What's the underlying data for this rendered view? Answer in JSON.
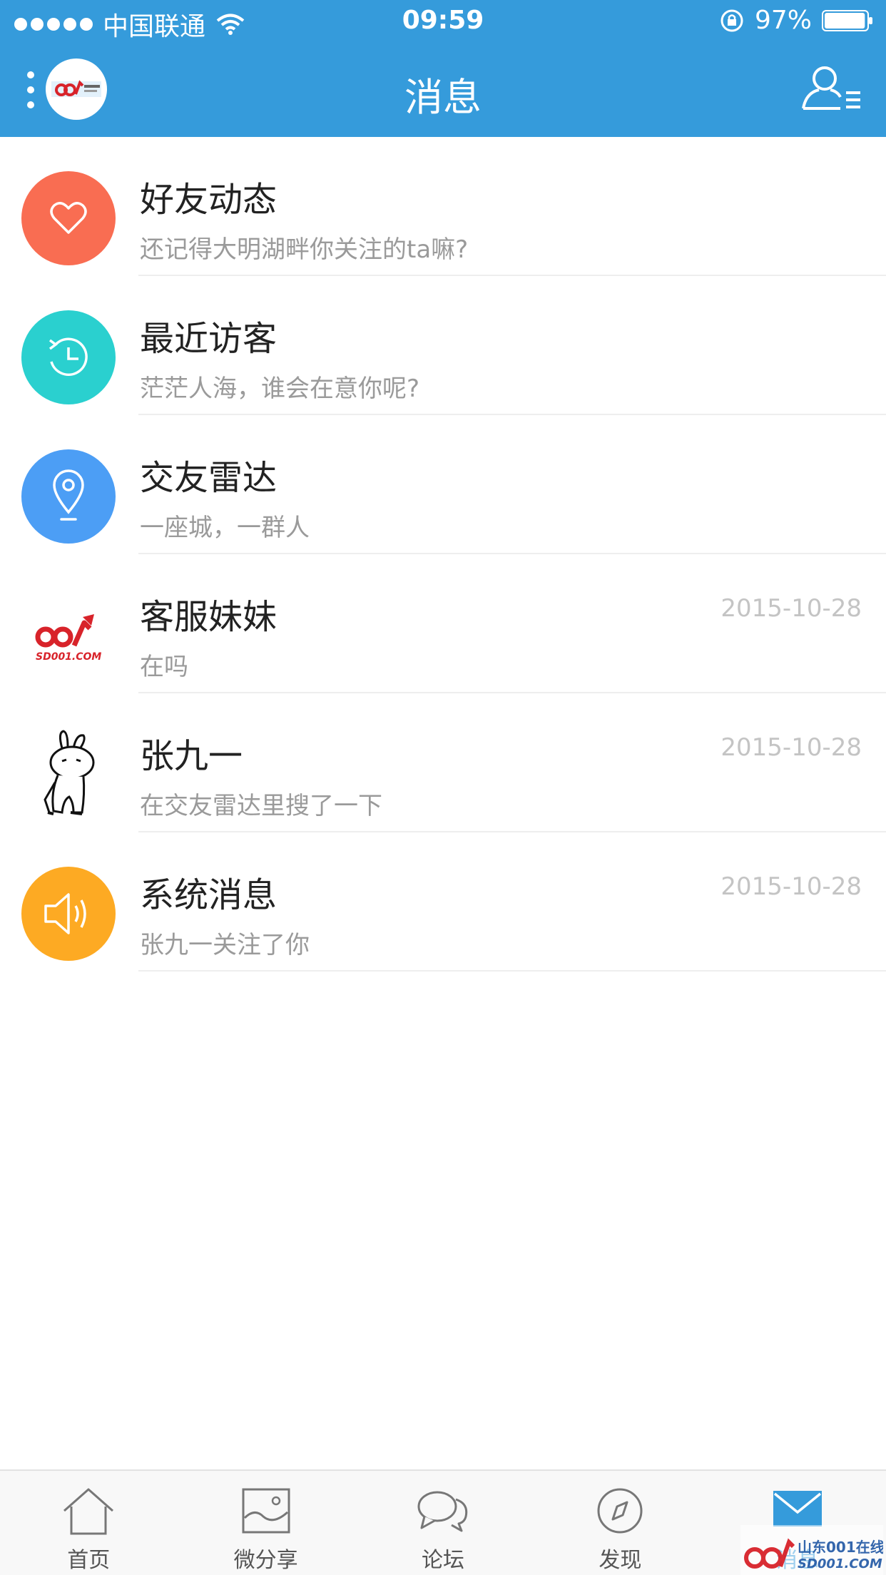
{
  "status_bar": {
    "carrier": "中国联通",
    "time": "09:59",
    "battery": "97%",
    "battery_level": 0.97
  },
  "nav": {
    "title": "消息",
    "logo_text": "山东001在线 SD001.COM"
  },
  "messages": [
    {
      "title": "好友动态",
      "subtitle": "还记得大明湖畔你关注的ta嘛?",
      "date": "",
      "icon": "heart-icon",
      "color": "#f96d52"
    },
    {
      "title": "最近访客",
      "subtitle": "茫茫人海，谁会在意你呢?",
      "date": "",
      "icon": "history-clock-icon",
      "color": "#2ad0cf"
    },
    {
      "title": "交友雷达",
      "subtitle": "一座城，一群人",
      "date": "",
      "icon": "location-pin-icon",
      "color": "#4c9ef5"
    },
    {
      "title": "客服妹妹",
      "subtitle": "在吗",
      "date": "2015-10-28",
      "icon": "sd001-logo-avatar",
      "color": "#ffffff"
    },
    {
      "title": "张九一",
      "subtitle": "在交友雷达里搜了一下",
      "date": "2015-10-28",
      "icon": "rabbit-avatar",
      "color": "#ffffff"
    },
    {
      "title": "系统消息",
      "subtitle": "张九一关注了你",
      "date": "2015-10-28",
      "icon": "speaker-icon",
      "color": "#fdaa23"
    }
  ],
  "tabs": [
    {
      "label": "首页",
      "icon": "home-icon",
      "active": false
    },
    {
      "label": "微分享",
      "icon": "image-icon",
      "active": false
    },
    {
      "label": "论坛",
      "icon": "chat-bubbles-icon",
      "active": false
    },
    {
      "label": "发现",
      "icon": "compass-icon",
      "active": false
    },
    {
      "label": "消息",
      "icon": "mail-icon",
      "active": true
    }
  ],
  "watermark": {
    "text_cn": "山东001在线",
    "text_en": "SD001.COM"
  },
  "colors": {
    "header": "#359bdb",
    "tab_active": "#359bdb",
    "tab_inactive": "#555555"
  }
}
